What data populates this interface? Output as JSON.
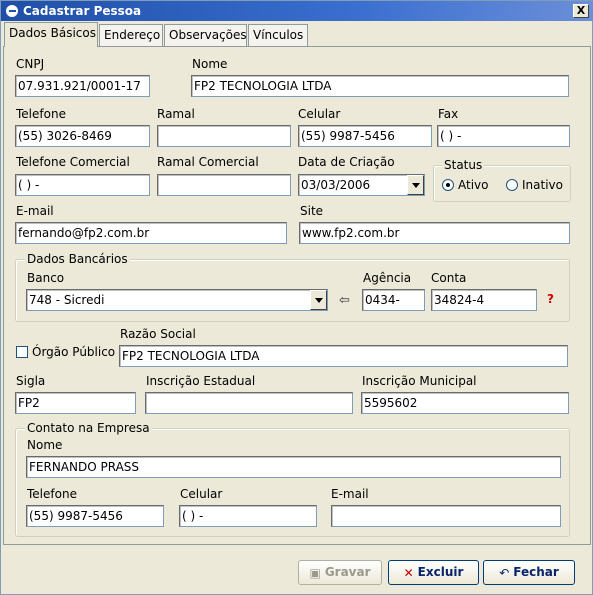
{
  "window": {
    "title": "Cadastrar Pessoa",
    "close_label": "X"
  },
  "tabs": [
    "Dados Básicos",
    "Endereço",
    "Observações",
    "Vínculos"
  ],
  "form": {
    "cnpj_label": "CNPJ",
    "cnpj": "07.931.921/0001-17",
    "nome_label": "Nome",
    "nome": "FP2 TECNOLOGIA LTDA",
    "telefone_label": "Telefone",
    "telefone": "(55) 3026-8469",
    "ramal_label": "Ramal",
    "ramal": "",
    "celular_label": "Celular",
    "celular": "(55) 9987-5456",
    "fax_label": "Fax",
    "fax": "( )    -",
    "tel_comercial_label": "Telefone Comercial",
    "tel_comercial": "( )    -",
    "ramal_comercial_label": "Ramal Comercial",
    "ramal_comercial": "",
    "data_criacao_label": "Data de Criação",
    "data_criacao": "03/03/2006",
    "status_title": "Status",
    "status_ativo": "Ativo",
    "status_inativo": "Inativo",
    "status_selected": "Ativo",
    "email_label": "E-mail",
    "email": "fernando@fp2.com.br",
    "site_label": "Site",
    "site": "www.fp2.com.br",
    "bank_title": "Dados Bancários",
    "banco_label": "Banco",
    "banco": "748 - Sicredi",
    "agencia_label": "Agência",
    "agencia": "0434-",
    "conta_label": "Conta",
    "conta": "34824-4",
    "help_mark": "?",
    "orgao_publico_label": "Órgão Público",
    "orgao_publico_checked": false,
    "razao_social_label": "Razão Social",
    "razao_social": "FP2 TECNOLOGIA LTDA",
    "sigla_label": "Sigla",
    "sigla": "FP2",
    "insc_estadual_label": "Inscrição Estadual",
    "insc_estadual": "",
    "insc_municipal_label": "Inscrição Municipal",
    "insc_municipal": "5595602"
  },
  "contato": {
    "title": "Contato na Empresa",
    "nome_label": "Nome",
    "nome": "FERNANDO PRASS",
    "telefone_label": "Telefone",
    "telefone": "(55) 9987-5456",
    "celular_label": "Celular",
    "celular": "( )    -",
    "email_label": "E-mail",
    "email": ""
  },
  "buttons": {
    "gravar": "Gravar",
    "excluir": "Excluir",
    "fechar": "Fechar"
  },
  "icons": {
    "app": "app-icon",
    "arrow": "arrow-left-icon",
    "save": "floppy-icon",
    "delete": "delete-icon",
    "undo": "undo-icon"
  }
}
